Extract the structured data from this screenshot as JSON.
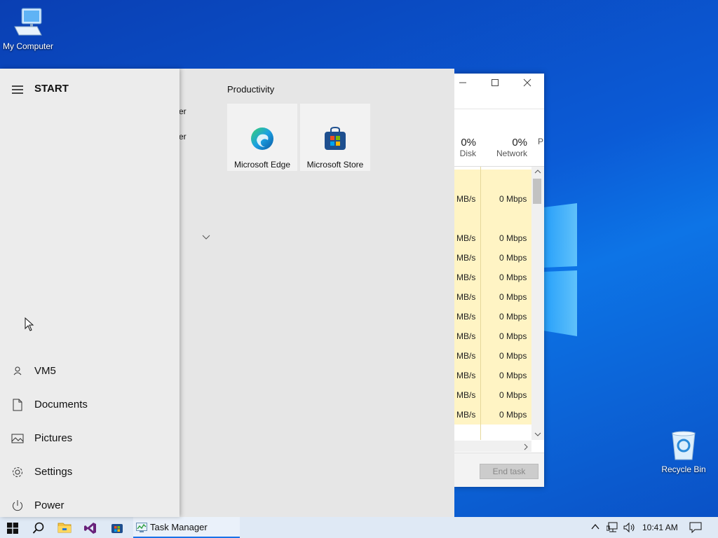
{
  "desktop": {
    "my_computer": "My Computer",
    "recycle_bin": "Recycle Bin"
  },
  "task_manager": {
    "columns": [
      {
        "pct": "0%",
        "label": "Disk"
      },
      {
        "pct": "0%",
        "label": "Network"
      },
      {
        "pct": "",
        "label": "P"
      }
    ],
    "rows": [
      {
        "disk": "",
        "net": ""
      },
      {
        "disk": "MB/s",
        "net": "0 Mbps"
      },
      {
        "disk": "",
        "net": ""
      },
      {
        "disk": "MB/s",
        "net": "0 Mbps"
      },
      {
        "disk": "MB/s",
        "net": "0 Mbps"
      },
      {
        "disk": "MB/s",
        "net": "0 Mbps"
      },
      {
        "disk": "MB/s",
        "net": "0 Mbps"
      },
      {
        "disk": "MB/s",
        "net": "0 Mbps"
      },
      {
        "disk": "MB/s",
        "net": "0 Mbps"
      },
      {
        "disk": "MB/s",
        "net": "0 Mbps"
      },
      {
        "disk": "MB/s",
        "net": "0 Mbps"
      },
      {
        "disk": "MB/s",
        "net": "0 Mbps"
      },
      {
        "disk": "MB/s",
        "net": "0 Mbps"
      }
    ],
    "end_task": "End task"
  },
  "start_menu": {
    "title": "START",
    "side_items": [
      {
        "label": "VM5",
        "icon": "user-icon"
      },
      {
        "label": "Documents",
        "icon": "document-icon"
      },
      {
        "label": "Pictures",
        "icon": "pictures-icon"
      },
      {
        "label": "Settings",
        "icon": "gear-icon"
      },
      {
        "label": "Power",
        "icon": "power-icon"
      }
    ],
    "list_fragments": [
      "er",
      "er"
    ],
    "group_title": "Productivity",
    "tiles": [
      {
        "label": "Microsoft Edge",
        "icon": "edge-icon"
      },
      {
        "label": "Microsoft Store",
        "icon": "store-icon"
      }
    ]
  },
  "taskbar": {
    "active_app": "Task Manager",
    "clock": "10:41 AM"
  },
  "colors": {
    "accent": "#1a73e8",
    "row_highlight": "#fff4c4",
    "start_bg": "#e6e6e6"
  }
}
